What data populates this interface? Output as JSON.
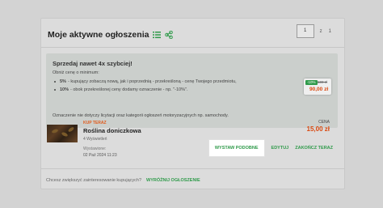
{
  "header": {
    "title": "Moje aktywne ogłoszenia",
    "icons": [
      "list-icon",
      "share-icon"
    ]
  },
  "pagination": {
    "current_page": "1",
    "separator": "z",
    "total_pages": "1"
  },
  "promo": {
    "title": "Sprzedaj nawet 4x szybciej!",
    "subtitle": "Obniż cenę o minimum:",
    "items": [
      {
        "bold": "5%",
        "text": "- kupujący zobaczą nową, jak i poprzednią - przekreśloną - cenę Twojego przedmiotu,"
      },
      {
        "bold": "10%",
        "text": "- obok przekreślonej ceny dodamy oznaczenie - np. \"-10%\"."
      }
    ],
    "note": "Oznaczenie nie dotyczy licytacji oraz kategorii ogłoszeń motoryzacyjnych np. samochody.",
    "example": {
      "badge": "-10%",
      "old_price": "100 zł",
      "new_price": "90,00 zł"
    }
  },
  "listing": {
    "type_label": "KUP TERAZ",
    "title": "Roślina doniczkowa",
    "views": "4 Wyświetleń",
    "issued_label": "Wystawione:",
    "issued_date": "02 Paź 2024 11:23",
    "price_label": "CENA",
    "price": "15,00 zł",
    "actions": {
      "similar": "WYSTAW PODOBNE",
      "edit": "EDYTUJ",
      "end": "ZAKOŃCZ TERAZ"
    }
  },
  "footer": {
    "question": "Chcesz zwiększyć zainteresowanie kupujących?",
    "link": "WYRÓŻNIJ OGŁOSZENIE"
  },
  "colors": {
    "accent_green": "#2f9a4a",
    "price_orange": "#d9480f",
    "overlay_gray": "#d3d3d3"
  }
}
